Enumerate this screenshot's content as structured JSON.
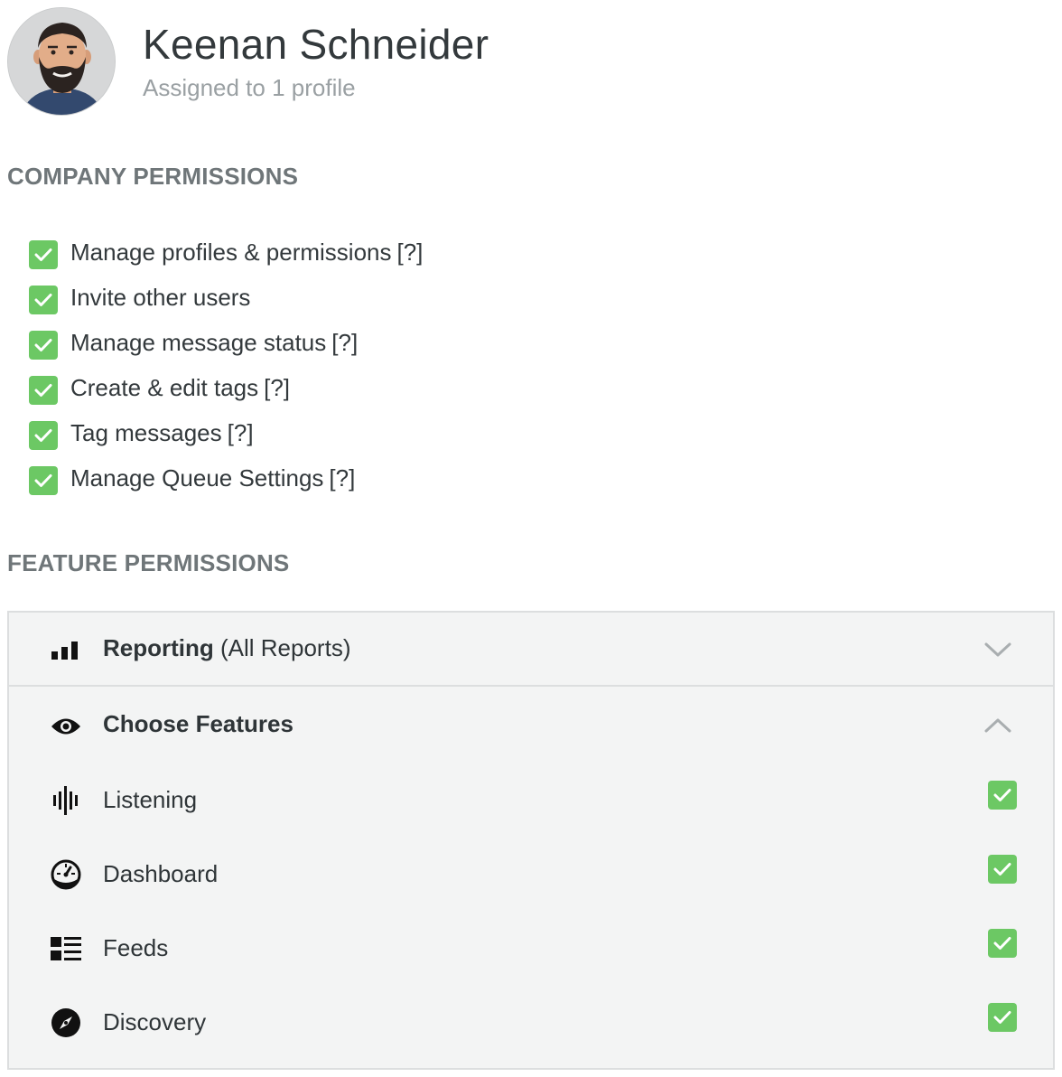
{
  "user": {
    "name": "Keenan Schneider",
    "subtitle": "Assigned to 1 profile"
  },
  "company_permissions": {
    "title": "COMPANY PERMISSIONS",
    "items": [
      {
        "label": "Manage profiles & permissions",
        "help": "[?]",
        "checked": true
      },
      {
        "label": "Invite other users",
        "help": "",
        "checked": true
      },
      {
        "label": "Manage message status",
        "help": "[?]",
        "checked": true
      },
      {
        "label": "Create & edit tags",
        "help": "[?]",
        "checked": true
      },
      {
        "label": "Tag messages",
        "help": "[?]",
        "checked": true
      },
      {
        "label": "Manage Queue Settings",
        "help": "[?]",
        "checked": true
      }
    ]
  },
  "feature_permissions": {
    "title": "FEATURE PERMISSIONS",
    "reporting": {
      "label": "Reporting",
      "detail": "(All Reports)",
      "icon": "bar-chart-icon",
      "expanded": false
    },
    "choose_features": {
      "label": "Choose Features",
      "icon": "eye-icon",
      "expanded": true,
      "items": [
        {
          "label": "Listening",
          "icon": "soundwave-icon",
          "checked": true
        },
        {
          "label": "Dashboard",
          "icon": "gauge-icon",
          "checked": true
        },
        {
          "label": "Feeds",
          "icon": "feed-list-icon",
          "checked": true
        },
        {
          "label": "Discovery",
          "icon": "compass-icon",
          "checked": true
        }
      ]
    }
  },
  "colors": {
    "check_green": "#6cc864",
    "panel_bg": "#f3f4f4",
    "heading_gray": "#6f7679",
    "subtle_gray": "#9aa0a3"
  }
}
